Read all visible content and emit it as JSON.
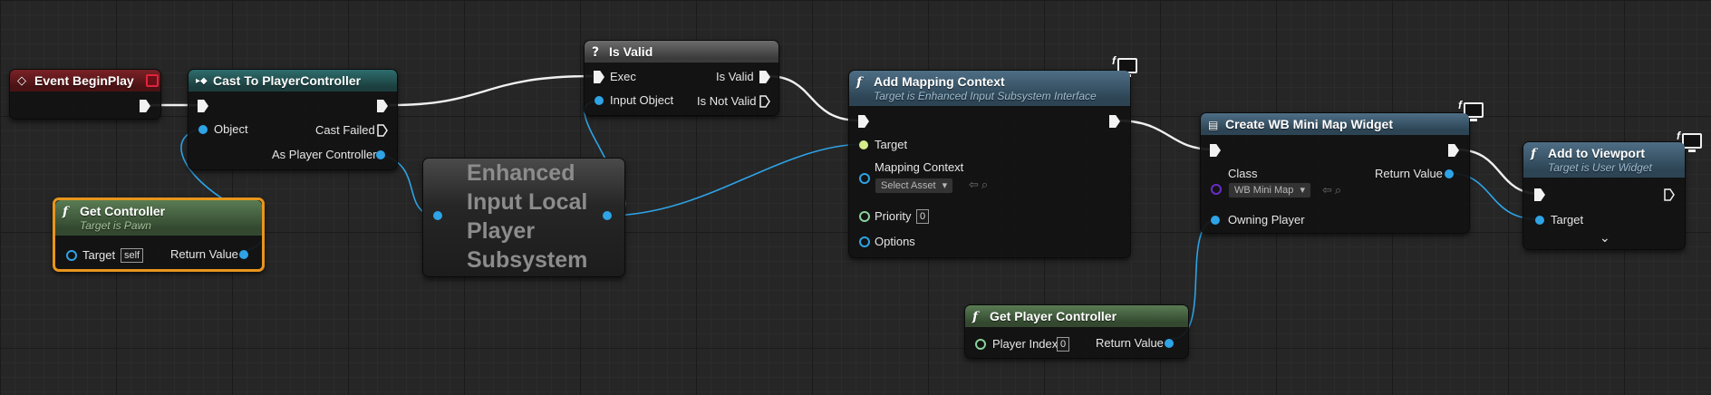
{
  "nodes": {
    "event_begin_play": {
      "title": "Event BeginPlay"
    },
    "cast": {
      "title": "Cast To PlayerController",
      "pins": {
        "object": "Object",
        "cast_failed": "Cast Failed",
        "as_player_controller": "As Player Controller"
      }
    },
    "is_valid": {
      "title": "Is Valid",
      "pins": {
        "exec": "Exec",
        "input_object": "Input Object",
        "is_valid": "Is Valid",
        "is_not_valid": "Is Not Valid"
      }
    },
    "get_controller": {
      "title": "Get Controller",
      "subtitle": "Target is Pawn",
      "pins": {
        "target": "Target",
        "target_default": "self",
        "return_value": "Return Value"
      }
    },
    "subsystem": {
      "title_lines": [
        "Enhanced",
        "Input Local",
        "Player",
        "Subsystem"
      ]
    },
    "add_mapping_context": {
      "title": "Add Mapping Context",
      "subtitle": "Target is Enhanced Input Subsystem Interface",
      "pins": {
        "target": "Target",
        "mapping_context": "Mapping Context",
        "select_asset": "Select Asset",
        "priority": "Priority",
        "priority_value": "0",
        "options": "Options"
      }
    },
    "create_widget": {
      "title": "Create WB Mini Map Widget",
      "pins": {
        "class": "Class",
        "class_value": "WB Mini Map",
        "owning_player": "Owning Player",
        "return_value": "Return Value"
      }
    },
    "get_player_controller": {
      "title": "Get Player Controller",
      "pins": {
        "player_index": "Player Index",
        "player_index_value": "0",
        "return_value": "Return Value"
      }
    },
    "add_to_viewport": {
      "title": "Add to Viewport",
      "subtitle": "Target is User Widget",
      "pins": {
        "target": "Target"
      }
    }
  },
  "icons": {
    "function": "f",
    "question": "?",
    "chevron_down": "⌄",
    "browse": "⇦",
    "search": "⚲"
  },
  "colors": {
    "exec_wire": "#f0f0f0",
    "object_pin": "#2ea3e6",
    "struct_pin": "#8ad29a",
    "class_pin": "#6a2cc8",
    "target_pin": "#d7ef8a",
    "selected_border": "#e8951b"
  }
}
